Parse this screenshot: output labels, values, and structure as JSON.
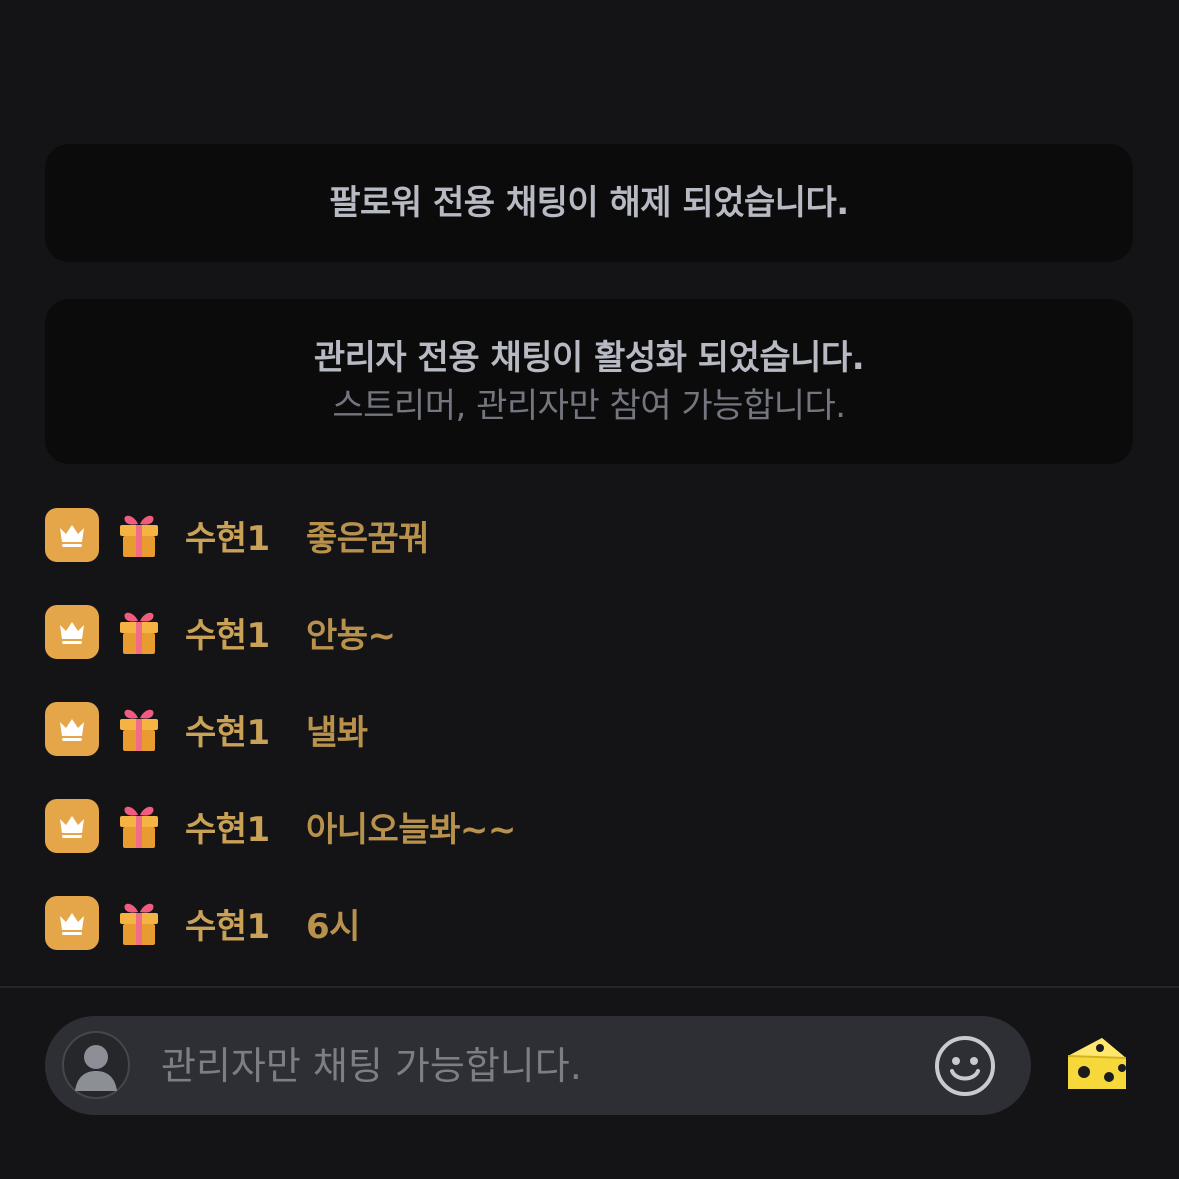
{
  "notices": [
    {
      "title": "팔로워 전용 채팅이 해제 되었습니다."
    },
    {
      "title": "관리자 전용 채팅이 활성화 되었습니다.",
      "subtitle": "스트리머, 관리자만 참여 가능합니다."
    }
  ],
  "chat": {
    "messages": [
      {
        "badge": "crown-icon",
        "gift": "gift-icon",
        "nickname": "수현1",
        "text": "좋은꿈꿔"
      },
      {
        "badge": "crown-icon",
        "gift": "gift-icon",
        "nickname": "수현1",
        "text": "안뇽~"
      },
      {
        "badge": "crown-icon",
        "gift": "gift-icon",
        "nickname": "수현1",
        "text": "낼봐"
      },
      {
        "badge": "crown-icon",
        "gift": "gift-icon",
        "nickname": "수현1",
        "text": "아니오늘봐~~"
      },
      {
        "badge": "crown-icon",
        "gift": "gift-icon",
        "nickname": "수현1",
        "text": "6시"
      }
    ]
  },
  "input": {
    "placeholder": "관리자만 채팅 가능합니다.",
    "avatar_icon": "user-avatar-icon",
    "emoji_icon": "smiley-icon",
    "cheese_icon": "cheese-icon"
  },
  "colors": {
    "background": "#141416",
    "notice_background": "#0b0b0c",
    "badge": "#e5a64a",
    "nickname": "#c9a157",
    "message": "#b8924c",
    "input_background": "#2e2f34",
    "cheese": "#f7d83a"
  }
}
